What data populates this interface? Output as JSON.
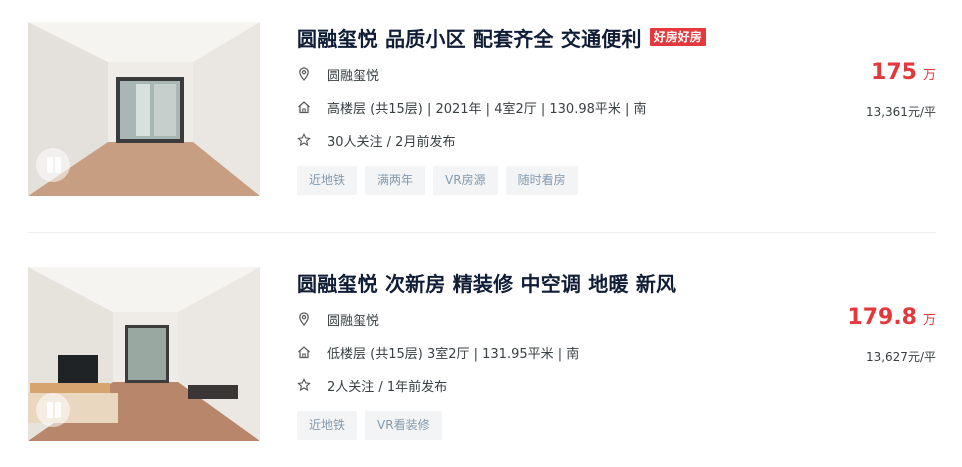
{
  "listings": [
    {
      "title": "圆融玺悦 品质小区 配套齐全 交通便利",
      "badge": "好房好房",
      "community": "圆融玺悦",
      "house_info": "高楼层 (共15层) | 2021年 | 4室2厅 | 130.98平米 | 南",
      "follow_info": "30人关注 / 2月前发布",
      "tags": [
        "近地铁",
        "满两年",
        "VR房源",
        "随时看房"
      ],
      "total_price": "175",
      "total_unit": "万",
      "unit_price": "13,361元/平"
    },
    {
      "title": "圆融玺悦 次新房 精装修 中空调 地暖 新风",
      "community": "圆融玺悦",
      "house_info": "低楼层 (共15层) 3室2厅 | 131.95平米 | 南",
      "follow_info": "2人关注 / 1年前发布",
      "tags": [
        "近地铁",
        "VR看装修"
      ],
      "total_price": "179.8",
      "total_unit": "万",
      "unit_price": "13,627元/平"
    }
  ],
  "colors": {
    "price": "#e4393c",
    "title": "#101d37",
    "tag_bg": "#f2f4f6",
    "tag_text": "#849aae"
  },
  "icons": [
    "location-pin-icon",
    "house-icon",
    "star-icon"
  ]
}
